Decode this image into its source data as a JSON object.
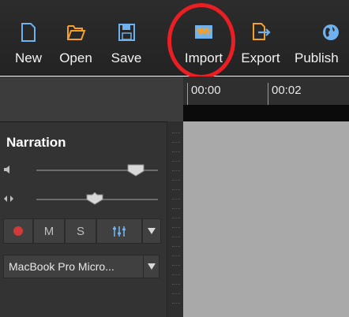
{
  "toolbar": {
    "buttons": [
      {
        "id": "new",
        "label": "New",
        "icon": "new-document-icon"
      },
      {
        "id": "open",
        "label": "Open",
        "icon": "open-folder-icon"
      },
      {
        "id": "save",
        "label": "Save",
        "icon": "save-disk-icon"
      },
      {
        "id": "import",
        "label": "Import",
        "icon": "import-media-icon"
      },
      {
        "id": "export",
        "label": "Export",
        "icon": "export-icon"
      },
      {
        "id": "publish",
        "label": "Publish",
        "icon": "globe-icon"
      }
    ]
  },
  "timeline": {
    "ticks": [
      "00:00",
      "00:02"
    ]
  },
  "track": {
    "name": "Narration",
    "mute_label": "M",
    "solo_label": "S",
    "input_device": "MacBook Pro Micro...",
    "volume_level": 0.82,
    "pan_level": 0.48
  },
  "colors": {
    "toolbar_bg": "#2a2a2a",
    "panel_bg": "#333333",
    "canvas_bg": "#a9a9a9",
    "accent_blue": "#6fb2ee",
    "accent_orange": "#f3a12b",
    "record_red": "#d23a3a",
    "highlight_red": "#ea1f24"
  }
}
